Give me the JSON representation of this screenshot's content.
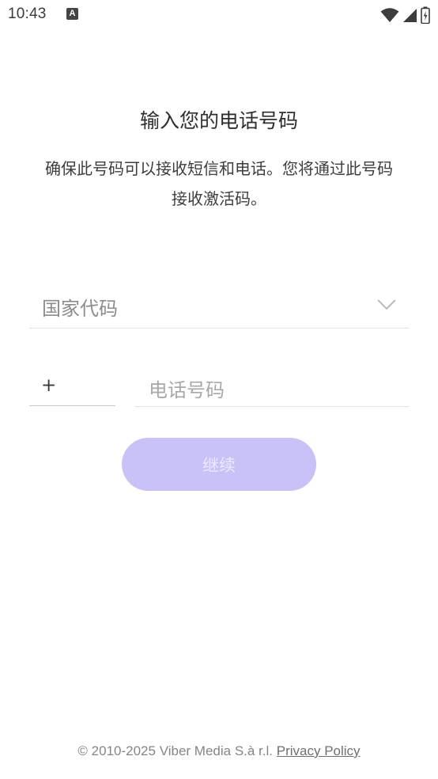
{
  "status_bar": {
    "time": "10:43",
    "notification_icon": "A",
    "icons": [
      "wifi-icon",
      "signal-icon",
      "battery-icon"
    ]
  },
  "header": {
    "title": "输入您的电话号码",
    "subtitle": "确保此号码可以接收短信和电话。您将通过此号码接收激活码。"
  },
  "form": {
    "country_code_placeholder": "国家代码",
    "prefix": "+",
    "phone_placeholder": "电话号码",
    "continue_label": "继续"
  },
  "footer": {
    "copyright": "© 2010-2025 Viber Media S.à r.l.",
    "privacy_link": "Privacy Policy"
  },
  "colors": {
    "button_bg": "#c8c2f7",
    "button_text": "#ece9fd",
    "divider": "#e2e2e2"
  }
}
